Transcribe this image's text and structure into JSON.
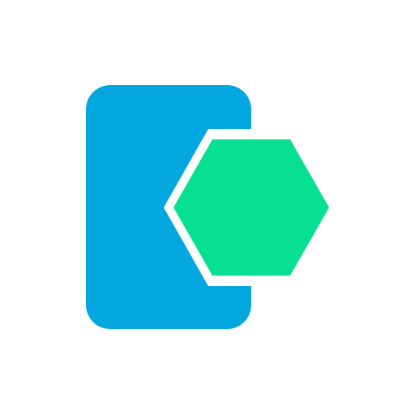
{
  "icon": {
    "name": "phone-with-hexagon-icon",
    "colors": {
      "background": "#ffffff",
      "device_body": "#02a7e0",
      "hexagon": "#07e093",
      "gap_outline": "#ffffff"
    }
  }
}
